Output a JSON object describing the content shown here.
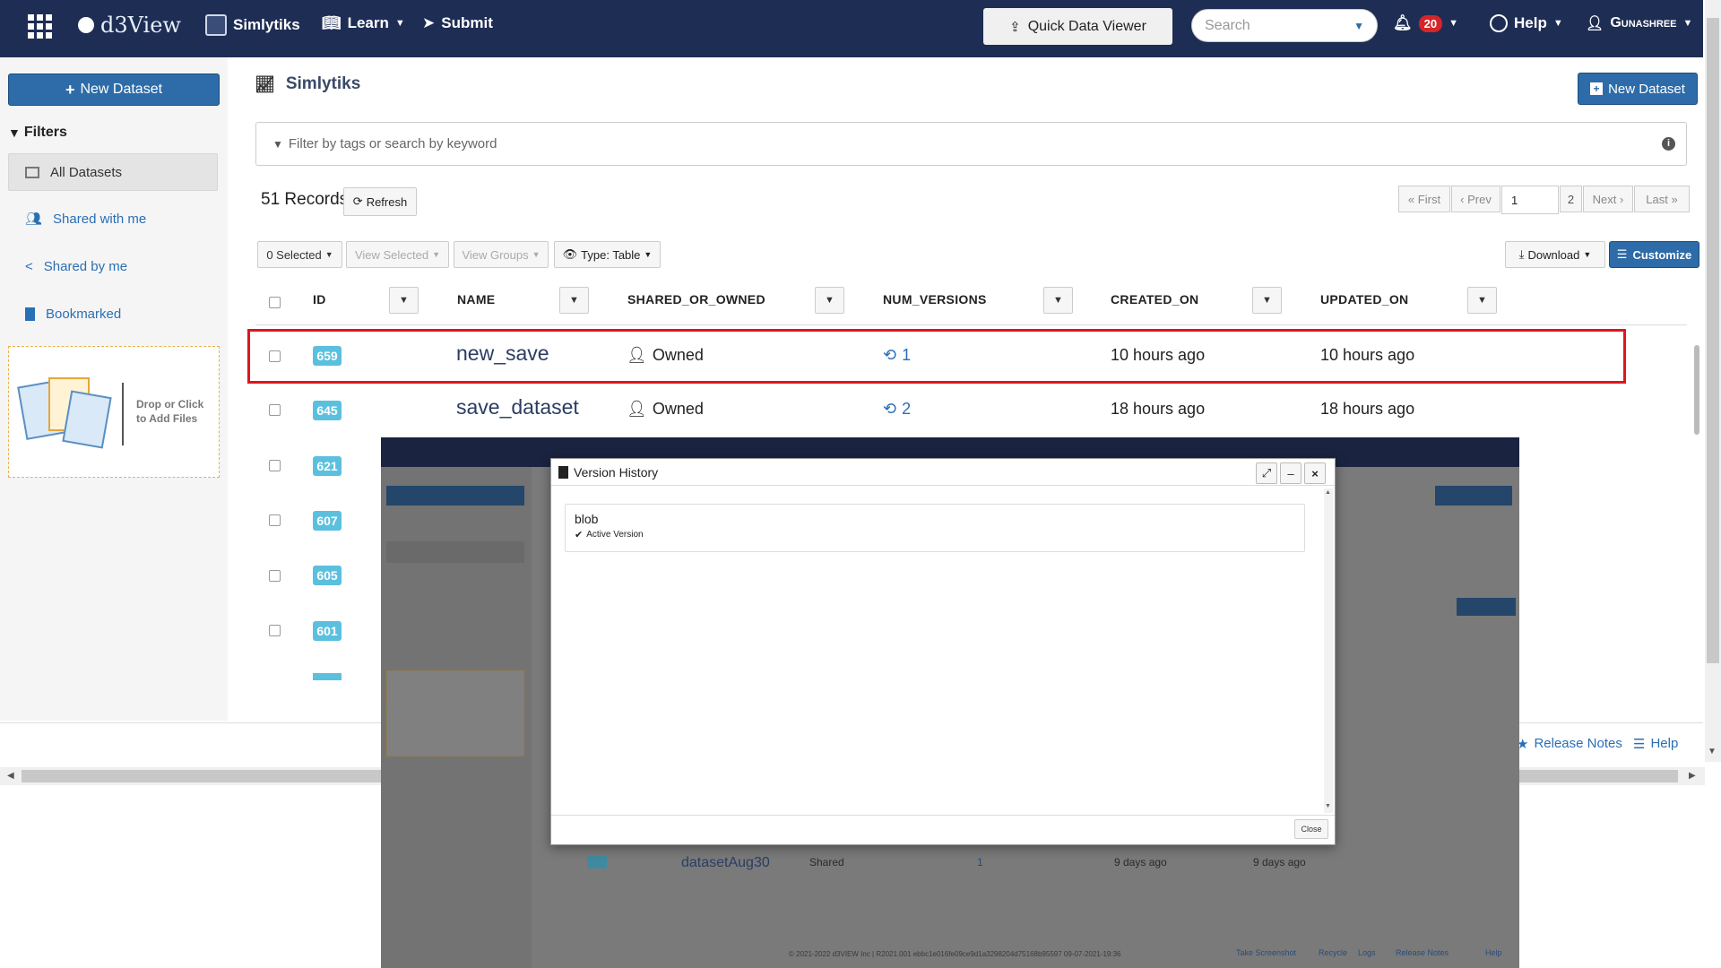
{
  "nav": {
    "brand": "d3View",
    "simlytiks": "Simlytiks",
    "learn": "Learn",
    "submit": "Submit",
    "quick_data_viewer": "Quick Data Viewer",
    "search_placeholder": "Search",
    "notif_count": "20",
    "help": "Help",
    "user": "Gunashree"
  },
  "sidebar": {
    "new_dataset": "New Dataset",
    "filters": "Filters",
    "all_datasets": "All Datasets",
    "shared_with_me": "Shared with me",
    "shared_by_me": "Shared by me",
    "bookmarked": "Bookmarked",
    "drop_text": "Drop or Click to Add Files"
  },
  "main": {
    "title": "Simlytiks",
    "new_dataset": "New Dataset",
    "filter_placeholder": "Filter by tags or search by keyword",
    "records": "51 Records",
    "refresh": "Refresh",
    "pager": {
      "first": "First",
      "prev": "Prev",
      "page": "1",
      "page2": "2",
      "next": "Next",
      "last": "Last"
    },
    "toolbar": {
      "selected": "0 Selected",
      "view_selected": "View Selected",
      "view_groups": "View Groups",
      "type": "Type: Table",
      "download": "Download",
      "customize": "Customize"
    },
    "columns": [
      "ID",
      "NAME",
      "SHARED_OR_OWNED",
      "NUM_VERSIONS",
      "CREATED_ON",
      "UPDATED_ON"
    ],
    "rows": [
      {
        "id": "659",
        "name": "new_save",
        "owned": "Owned",
        "versions": "1",
        "created": "10 hours ago",
        "updated": "10 hours ago"
      },
      {
        "id": "645",
        "name": "save_dataset",
        "owned": "Owned",
        "versions": "2",
        "created": "18 hours ago",
        "updated": "18 hours ago"
      },
      {
        "id": "621"
      },
      {
        "id": "607"
      },
      {
        "id": "605"
      },
      {
        "id": "601"
      }
    ]
  },
  "footer": {
    "release_notes": "Release Notes",
    "help": "Help"
  },
  "modal": {
    "title": "Version History",
    "version_name": "blob",
    "version_status": "Active Version",
    "close": "Close"
  },
  "background": {
    "row_name": "datasetAug30",
    "row_shared": "Shared",
    "row_versions": "1",
    "row_created": "9 days ago",
    "row_updated": "9 days ago",
    "copyright": "© 2021-2022 d3VIEW Inc | R2021.001 ebbc1e016fe09ce9d1a3298204d75168b95597 09-07-2021-19:36",
    "take_screenshot": "Take Screenshot",
    "recycle": "Recycle",
    "logs": "Logs",
    "release_notes": "Release Notes",
    "help": "Help"
  },
  "colors": {
    "navbar": "#1e2d54",
    "primary": "#2d6ca8",
    "badge": "#5bc0de",
    "highlight": "#e0141e",
    "notif": "#d4252a"
  }
}
